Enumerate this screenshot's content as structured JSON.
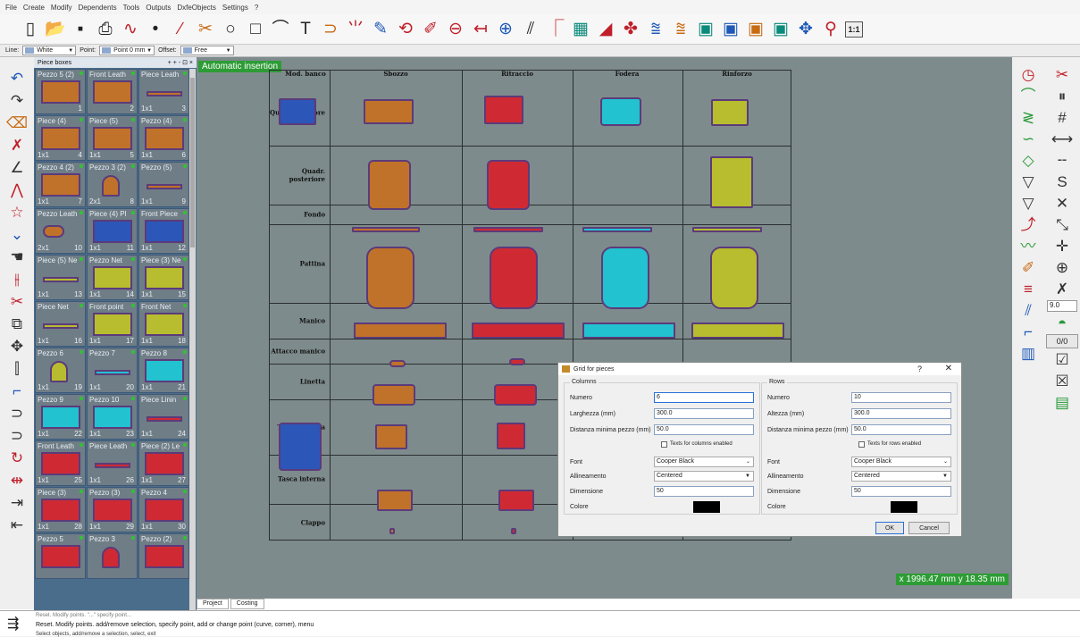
{
  "menu": [
    "File",
    "Create",
    "Modify",
    "Dependents",
    "Tools",
    "Outputs",
    "DxfeObjects",
    "Settings",
    "?"
  ],
  "toolbar": {
    "icons": [
      {
        "name": "new-file-icon",
        "g": "▯",
        "c": ""
      },
      {
        "name": "open-folder-icon",
        "g": "📂",
        "c": "o"
      },
      {
        "name": "save-icon",
        "g": "▪",
        "c": ""
      },
      {
        "name": "print-icon",
        "g": "⎙",
        "c": ""
      },
      {
        "name": "curve-icon",
        "g": "∿",
        "c": "r"
      },
      {
        "name": "point-icon",
        "g": "•",
        "c": ""
      },
      {
        "name": "line-icon",
        "g": "∕",
        "c": "r"
      },
      {
        "name": "scissors-icon",
        "g": "✂",
        "c": "o"
      },
      {
        "name": "circle-icon",
        "g": "○",
        "c": ""
      },
      {
        "name": "rectangle-icon",
        "g": "□",
        "c": ""
      },
      {
        "name": "fillet-icon",
        "g": "⌒",
        "c": ""
      },
      {
        "name": "text-icon",
        "g": "T",
        "c": ""
      },
      {
        "name": "arc-tool-icon",
        "g": "⊃",
        "c": "o"
      },
      {
        "name": "fan-icon",
        "g": "⺌",
        "c": "r"
      },
      {
        "name": "pencil-icon",
        "g": "✎",
        "c": "b"
      },
      {
        "name": "flip-icon",
        "g": "⟲",
        "c": "r"
      },
      {
        "name": "brush-icon",
        "g": "✐",
        "c": "r"
      },
      {
        "name": "notch-icon",
        "g": "⊖",
        "c": "r"
      },
      {
        "name": "connect-icon",
        "g": "↤",
        "c": "r"
      },
      {
        "name": "mirror-icon",
        "g": "⊕",
        "c": "b"
      },
      {
        "name": "parallel-icon",
        "g": "⫽",
        "c": ""
      },
      {
        "name": "offset-icon",
        "g": "⎾",
        "c": "r"
      },
      {
        "name": "grid-layout-icon",
        "g": "▦",
        "c": "g"
      },
      {
        "name": "layers-icon",
        "g": "◢",
        "c": "r"
      },
      {
        "name": "group-icon",
        "g": "✤",
        "c": "r"
      },
      {
        "name": "duplicate-icon",
        "g": "⩰",
        "c": "b"
      },
      {
        "name": "copy-row-icon",
        "g": "⩰",
        "c": "o"
      },
      {
        "name": "grid-pieces-icon",
        "g": "▣",
        "c": "g"
      },
      {
        "name": "grid-pieces-alt-icon",
        "g": "▣",
        "c": "b"
      },
      {
        "name": "grid-pieces-color-icon",
        "g": "▣",
        "c": "o"
      },
      {
        "name": "grid-pieces-outline-icon",
        "g": "▣",
        "c": "g"
      },
      {
        "name": "pin-icon",
        "g": "✥",
        "c": "b"
      },
      {
        "name": "magnet-icon",
        "g": "⚲",
        "c": "r"
      }
    ],
    "zoom": "1:1"
  },
  "props": {
    "line_label": "Line:",
    "line_value": "White",
    "point_label": "Point:",
    "point_value": "Point 0 mm",
    "offset_label": "Offset:",
    "offset_value": "Free"
  },
  "left_tools": [
    {
      "name": "undo-icon",
      "g": "↶",
      "c": "b"
    },
    {
      "name": "redo-icon",
      "g": "↷",
      "c": ""
    },
    {
      "name": "eraser-icon",
      "g": "⌫",
      "c": "o"
    },
    {
      "name": "cut-line-icon",
      "g": "✗",
      "c": "r"
    },
    {
      "name": "angle-icon",
      "g": "∠",
      "c": ""
    },
    {
      "name": "peak-icon",
      "g": "⋀",
      "c": "r"
    },
    {
      "name": "star-icon",
      "g": "☆",
      "c": "r"
    },
    {
      "name": "dart-icon",
      "g": "⌄",
      "c": "b"
    },
    {
      "name": "hand-icon",
      "g": "☚",
      "c": ""
    },
    {
      "name": "split-icon",
      "g": "⫲",
      "c": "r"
    },
    {
      "name": "scissors-red-icon",
      "g": "✂",
      "c": "r"
    },
    {
      "name": "copy-shape-icon",
      "g": "⧉",
      "c": ""
    },
    {
      "name": "move-icon",
      "g": "✥",
      "c": ""
    },
    {
      "name": "align-icon",
      "g": "⫿",
      "c": ""
    },
    {
      "name": "corner-icon",
      "g": "⌐",
      "c": "b"
    },
    {
      "name": "flip-h-icon",
      "g": "⊃",
      "c": ""
    },
    {
      "name": "flip-v-icon",
      "g": "⊃",
      "c": ""
    },
    {
      "name": "rotate-icon",
      "g": "↻",
      "c": "r"
    },
    {
      "name": "measure-icon",
      "g": "⇹",
      "c": "r"
    },
    {
      "name": "import-icon",
      "g": "⇥",
      "c": ""
    },
    {
      "name": "export-icon",
      "g": "⇤",
      "c": ""
    }
  ],
  "piece_boxes": {
    "title": "Piece boxes",
    "controls": "+ + - ⊡ ×",
    "cells": [
      {
        "name": "Pezzo 5 (2)",
        "size": "",
        "num": "1",
        "color": "#c0722a",
        "shape": "rect"
      },
      {
        "name": "Front Leath",
        "size": "",
        "num": "2",
        "color": "#c0722a",
        "shape": "rect"
      },
      {
        "name": "Piece Leath",
        "size": "1x1",
        "num": "3",
        "color": "#c0722a",
        "shape": "bar"
      },
      {
        "name": "Piece (4)",
        "size": "1x1",
        "num": "4",
        "color": "#c0722a",
        "shape": "rect"
      },
      {
        "name": "Piece (5)",
        "size": "1x1",
        "num": "5",
        "color": "#c0722a",
        "shape": "rect"
      },
      {
        "name": "Pezzo (4)",
        "size": "1x1",
        "num": "6",
        "color": "#c0722a",
        "shape": "rect"
      },
      {
        "name": "Pezzo 4 (2)",
        "size": "1x1",
        "num": "7",
        "color": "#c0722a",
        "shape": "rect"
      },
      {
        "name": "Pezzo 3 (2)",
        "size": "2x1",
        "num": "8",
        "color": "#c0722a",
        "shape": "arch"
      },
      {
        "name": "Pezzo (5)",
        "size": "1x1",
        "num": "9",
        "color": "#c0722a",
        "shape": "bar"
      },
      {
        "name": "Pezzo Leath",
        "size": "2x1",
        "num": "10",
        "color": "#c0722a",
        "shape": "key"
      },
      {
        "name": "Piece (4) Pl",
        "size": "1x1",
        "num": "11",
        "color": "#2c56b8",
        "shape": "rect"
      },
      {
        "name": "Front Piece",
        "size": "1x1",
        "num": "12",
        "color": "#2c56b8",
        "shape": "rect"
      },
      {
        "name": "Piece (5) Ne",
        "size": "1x1",
        "num": "13",
        "color": "#b7bd2e",
        "shape": "bar"
      },
      {
        "name": "Pezzo Net",
        "size": "1x1",
        "num": "14",
        "color": "#b7bd2e",
        "shape": "rect"
      },
      {
        "name": "Piece (3) Ne",
        "size": "1x1",
        "num": "15",
        "color": "#b7bd2e",
        "shape": "rect"
      },
      {
        "name": "Piece Net",
        "size": "1x1",
        "num": "16",
        "color": "#b7bd2e",
        "shape": "bar"
      },
      {
        "name": "Front point",
        "size": "1x1",
        "num": "17",
        "color": "#b7bd2e",
        "shape": "rect"
      },
      {
        "name": "Front Net",
        "size": "1x1",
        "num": "18",
        "color": "#b7bd2e",
        "shape": "rect"
      },
      {
        "name": "Pezzo 6",
        "size": "1x1",
        "num": "19",
        "color": "#b7bd2e",
        "shape": "arch"
      },
      {
        "name": "Pezzo 7",
        "size": "1x1",
        "num": "20",
        "color": "#22c2d0",
        "shape": "bar"
      },
      {
        "name": "Pezzo 8",
        "size": "1x1",
        "num": "21",
        "color": "#22c2d0",
        "shape": "rect"
      },
      {
        "name": "Pezzo 9",
        "size": "1x1",
        "num": "22",
        "color": "#22c2d0",
        "shape": "rect"
      },
      {
        "name": "Pezzo 10",
        "size": "1x1",
        "num": "23",
        "color": "#22c2d0",
        "shape": "rect"
      },
      {
        "name": "Piece Linin",
        "size": "1x1",
        "num": "24",
        "color": "#cf2a33",
        "shape": "bar"
      },
      {
        "name": "Front Leath",
        "size": "1x1",
        "num": "25",
        "color": "#cf2a33",
        "shape": "rect"
      },
      {
        "name": "Piece Leath",
        "size": "1x1",
        "num": "26",
        "color": "#cf2a33",
        "shape": "bar"
      },
      {
        "name": "Piece (2) Le",
        "size": "1x1",
        "num": "27",
        "color": "#cf2a33",
        "shape": "rect"
      },
      {
        "name": "Piece (3)",
        "size": "1x1",
        "num": "28",
        "color": "#cf2a33",
        "shape": "rect"
      },
      {
        "name": "Pezzo (3)",
        "size": "1x1",
        "num": "29",
        "color": "#cf2a33",
        "shape": "rect"
      },
      {
        "name": "Pezzo 4",
        "size": "1x1",
        "num": "30",
        "color": "#cf2a33",
        "shape": "rect"
      },
      {
        "name": "Pezzo 5",
        "size": "",
        "num": "",
        "color": "#cf2a33",
        "shape": "rect"
      },
      {
        "name": "Pezzo 3",
        "size": "",
        "num": "",
        "color": "#cf2a33",
        "shape": "arch"
      },
      {
        "name": "Pezzo (2)",
        "size": "",
        "num": "",
        "color": "#cf2a33",
        "shape": "rect"
      }
    ]
  },
  "canvas": {
    "auto_insertion": "Automatic insertion",
    "columns": [
      "Mod. banco",
      "Sbozzo",
      "Ritraccio",
      "Fodera",
      "Rinforzo"
    ],
    "rows": [
      "Quad. anteriore",
      "Quadr. posteriore",
      "Fondo",
      "Pattina",
      "Manico",
      "Attacco manico",
      "Linetta",
      "Tasca esterna",
      "Tasca interna",
      "Clappo"
    ],
    "coord": "x 1996.47 mm  y 18.35 mm"
  },
  "right_tools": {
    "col1": [
      {
        "name": "clock-icon",
        "g": "◷",
        "c": "r"
      },
      {
        "name": "arc-curve-icon",
        "g": "⌒",
        "c": "g"
      },
      {
        "name": "zigzag-icon",
        "g": "≷",
        "c": "g"
      },
      {
        "name": "squiggle-icon",
        "g": "∽",
        "c": "g"
      },
      {
        "name": "diamond-icon",
        "g": "◇",
        "c": "g"
      },
      {
        "name": "triangle-down-icon",
        "g": "▽",
        "c": ""
      },
      {
        "name": "triangle-down-alt-icon",
        "g": "▽",
        "c": ""
      },
      {
        "name": "corner-arrow-icon",
        "g": "⤴",
        "c": "r"
      },
      {
        "name": "wave-icon",
        "g": "〰",
        "c": "g"
      },
      {
        "name": "feather-icon",
        "g": "✐",
        "c": "o"
      },
      {
        "name": "stack-icon",
        "g": "≡",
        "c": "r"
      },
      {
        "name": "sew-icon",
        "g": "⫽",
        "c": "b"
      },
      {
        "name": "hook-icon",
        "g": "⌐",
        "c": "b"
      },
      {
        "name": "book-icon",
        "g": "▥",
        "c": "b"
      }
    ],
    "col2": [
      {
        "name": "cut-pattern-icon",
        "g": "✂",
        "c": "r"
      },
      {
        "name": "pause-bars-icon",
        "g": "⏸",
        "c": ""
      },
      {
        "name": "hash-icon",
        "g": "#",
        "c": ""
      },
      {
        "name": "horizontal-line-icon",
        "g": "⟷",
        "c": ""
      },
      {
        "name": "dash-icon",
        "g": "╌",
        "c": ""
      },
      {
        "name": "s-curve-icon",
        "g": "S",
        "c": ""
      },
      {
        "name": "cross-icon",
        "g": "✕",
        "c": ""
      },
      {
        "name": "arrow-angle-icon",
        "g": "⤡",
        "c": ""
      },
      {
        "name": "plus-arrows-icon",
        "g": "✛",
        "c": ""
      },
      {
        "name": "target-icon",
        "g": "⊕",
        "c": ""
      },
      {
        "name": "x-needle-icon",
        "g": "✗",
        "c": ""
      }
    ],
    "field": "9.0",
    "count": "0/0",
    "col2b": [
      {
        "name": "pie-chart-icon",
        "g": "◓",
        "c": "g"
      },
      {
        "name": "checklist-icon",
        "g": "☑",
        "c": ""
      },
      {
        "name": "delete-box-icon",
        "g": "☒",
        "c": ""
      },
      {
        "name": "sheet-icon",
        "g": "▤",
        "c": "g"
      }
    ]
  },
  "dialog": {
    "title": "Grid for pieces",
    "help": "?",
    "close": "✕",
    "columns": {
      "title": "Columns",
      "numero_label": "Numero",
      "numero_value": "6",
      "larghezza_label": "Larghezza (mm)",
      "larghezza_value": "300.0",
      "distanza_label": "Distanza minima pezzo (mm)",
      "distanza_value": "50.0",
      "texts_label": "Texts for columns enabled",
      "font_label": "Font",
      "font_value": "Cooper Black",
      "allineamento_label": "Allineamento",
      "allineamento_value": "Centered",
      "dimensione_label": "Dimensione",
      "dimensione_value": "50",
      "colore_label": "Colore"
    },
    "rows": {
      "title": "Rows",
      "numero_label": "Numero",
      "numero_value": "10",
      "altezza_label": "Altezza (mm)",
      "altezza_value": "300.0",
      "distanza_label": "Distanza minima pezzo (mm)",
      "distanza_value": "50.0",
      "texts_label": "Texts for rows enabled",
      "font_label": "Font",
      "font_value": "Cooper Black",
      "allineamento_label": "Allineamento",
      "allineamento_value": "Centered",
      "dimensione_label": "Dimensione",
      "dimensione_value": "50",
      "colore_label": "Colore"
    },
    "ok": "OK",
    "cancel": "Cancel"
  },
  "bottom": {
    "tabs": [
      "Project",
      "Costing"
    ],
    "line1": "Reset. Modify points. \"...\" specify point...",
    "line2": "Reset. Modify points. add/remove selection, specify point, add or change point (curve, corner), menu",
    "line3": "Select objects, add/remove a selection, select, exit"
  }
}
